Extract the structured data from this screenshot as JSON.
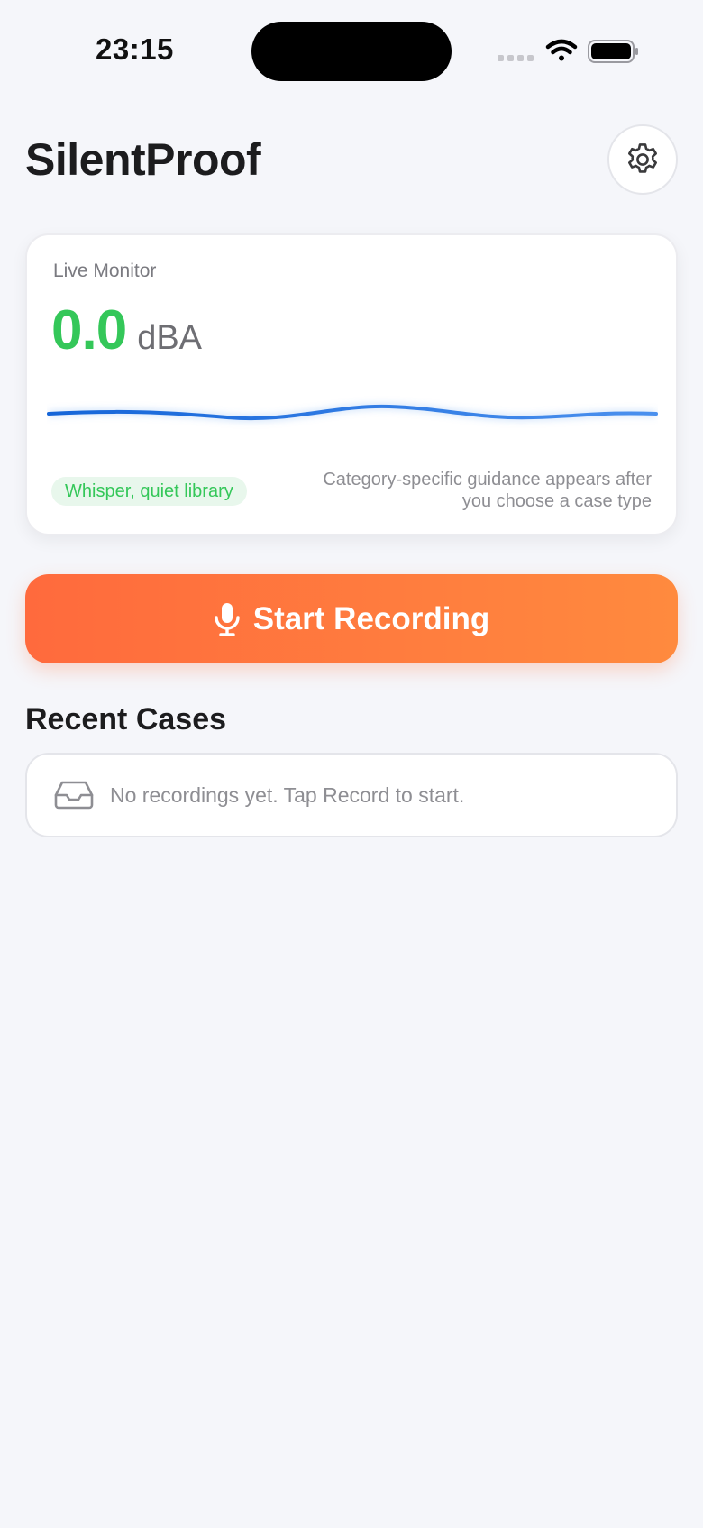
{
  "status_bar": {
    "time": "23:15"
  },
  "header": {
    "title": "SilentProof",
    "settings_icon": "gear-icon"
  },
  "monitor": {
    "label": "Live Monitor",
    "level_value": "0.0",
    "level_unit": "dBA",
    "category_badge": "Whisper, quiet library",
    "guidance": "Category-specific guidance appears after you choose a case type"
  },
  "record": {
    "label": "Start Recording",
    "icon": "microphone-icon"
  },
  "recent": {
    "title": "Recent Cases",
    "empty_icon": "inbox-icon",
    "empty_message": "No recordings yet. Tap Record to start."
  },
  "colors": {
    "background": "#f5f6fa",
    "level_green": "#34c759",
    "accent_orange_start": "#ff6a3d",
    "accent_orange_end": "#ff8a3e",
    "wave_blue": "#1f6fe0"
  }
}
